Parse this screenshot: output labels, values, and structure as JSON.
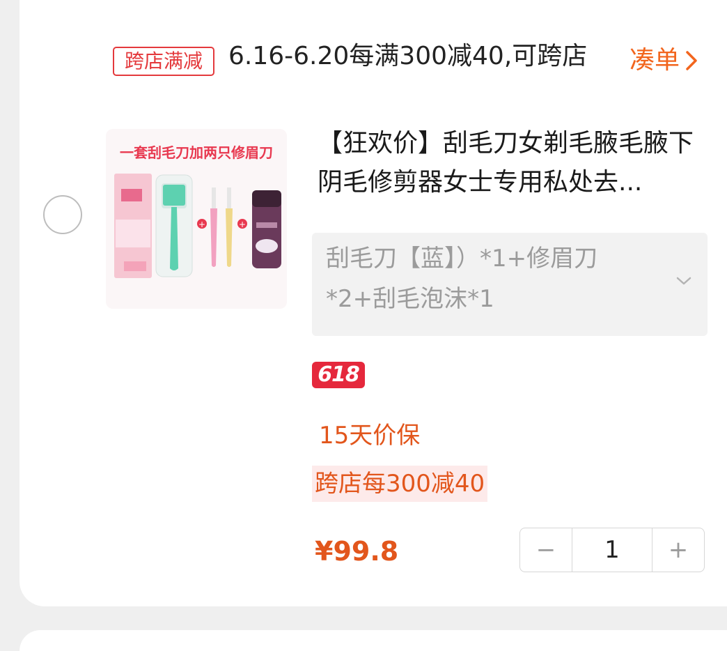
{
  "promo": {
    "tag": "跨店满减",
    "text": "6.16-6.20每满300减40,可跨店",
    "link": "凑单",
    "link_icon": "chevron-right-icon"
  },
  "product": {
    "image_caption": "一套刮毛刀加两只修眉刀",
    "title": "【狂欢价】刮毛刀女剃毛腋毛腋下阴毛修剪器女士专用私处去...",
    "sku": "刮毛刀【蓝】）*1+修眉刀*2+刮毛泡沫*1",
    "badge": "618",
    "price_protect": "15天价保",
    "discount": "跨店每300减40",
    "price": "¥99.8",
    "quantity": "1"
  },
  "stepper": {
    "minus": "−",
    "plus": "+"
  },
  "colors": {
    "accent": "#e2561c",
    "red": "#e4393c",
    "badge": "#e5283c"
  }
}
